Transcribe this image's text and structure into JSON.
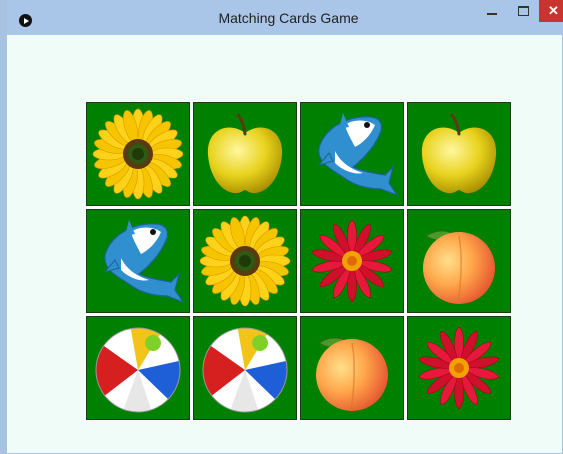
{
  "window": {
    "title": "Matching Cards Game",
    "close_label": "✕",
    "icon": "app-play-icon"
  },
  "board": {
    "rows": 3,
    "columns": 4,
    "card_back_color": "#008000",
    "cards": [
      {
        "image": "sunflower"
      },
      {
        "image": "apple"
      },
      {
        "image": "shark"
      },
      {
        "image": "apple"
      },
      {
        "image": "shark"
      },
      {
        "image": "sunflower"
      },
      {
        "image": "red-flower"
      },
      {
        "image": "peach"
      },
      {
        "image": "beach-ball"
      },
      {
        "image": "beach-ball"
      },
      {
        "image": "peach"
      },
      {
        "image": "red-flower"
      }
    ]
  }
}
